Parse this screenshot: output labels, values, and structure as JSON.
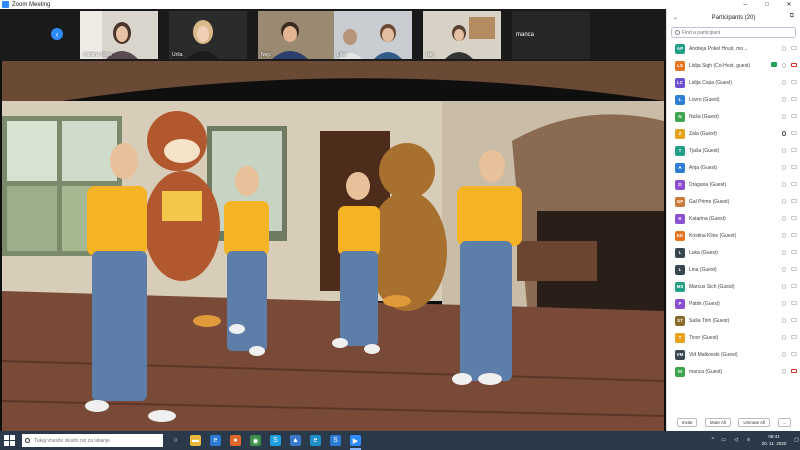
{
  "window": {
    "title": "Zoom Meeting",
    "controls": [
      "–",
      "□",
      "✕"
    ]
  },
  "thumbnails": [
    {
      "name": "Kristina Kline"
    },
    {
      "name": "Urša"
    },
    {
      "name": "Nejc"
    },
    {
      "name": "Ljko"
    },
    {
      "name": "Nej"
    },
    {
      "name": "manca"
    }
  ],
  "participants_panel": {
    "title": "Participants (20)",
    "search_placeholder": "Find a participant",
    "items": [
      {
        "initials": "AP",
        "name": "Andreja Pokel Hrust, mo...",
        "color": "#21a085",
        "mic": "muted",
        "cam": "on"
      },
      {
        "initials": "LS",
        "name": "Lidija Šigh (Co-Host, guest)",
        "color": "#e5741d",
        "mic": "muted",
        "cam": "off-red",
        "video": true
      },
      {
        "initials": "LC",
        "name": "Lidija Čupa (Guest)",
        "color": "#6b4fcf",
        "mic": "muted",
        "cam": "off"
      },
      {
        "initials": "L",
        "name": "Lovro (Guest)",
        "color": "#2f7fd6",
        "mic": "muted",
        "cam": "off"
      },
      {
        "initials": "N",
        "name": "Nuša (Guest)",
        "color": "#3ea64d",
        "mic": "muted",
        "cam": "off"
      },
      {
        "initials": "Z",
        "name": "Zala (Guest)",
        "color": "#e5a21d",
        "mic": "on",
        "cam": "off"
      },
      {
        "initials": "T",
        "name": "Tjaša (Guest)",
        "color": "#21a085",
        "mic": "muted",
        "cam": "off"
      },
      {
        "initials": "A",
        "name": "Anja (Guest)",
        "color": "#2f7fd6",
        "mic": "muted",
        "cam": "off"
      },
      {
        "initials": "D",
        "name": "Dragana (Guest)",
        "color": "#8c4fcf",
        "mic": "muted",
        "cam": "off"
      },
      {
        "initials": "GP",
        "name": "Gal Prime (Guest)",
        "color": "#c77a3a",
        "mic": "muted",
        "cam": "off"
      },
      {
        "initials": "K",
        "name": "Katarina (Guest)",
        "color": "#8c4fcf",
        "mic": "muted",
        "cam": "off"
      },
      {
        "initials": "KK",
        "name": "Kristina Kline (Guest)",
        "color": "#e5741d",
        "mic": "muted",
        "cam": "off"
      },
      {
        "initials": "L",
        "name": "Luka (Guest)",
        "color": "#37474f",
        "mic": "muted",
        "cam": "off"
      },
      {
        "initials": "L",
        "name": "Lina (Guest)",
        "color": "#37474f",
        "mic": "muted",
        "cam": "off"
      },
      {
        "initials": "MS",
        "name": "Marcus Sich (Guest)",
        "color": "#21a085",
        "mic": "muted",
        "cam": "off"
      },
      {
        "initials": "P",
        "name": "Patrik (Guest)",
        "color": "#8c4fcf",
        "mic": "muted",
        "cam": "off"
      },
      {
        "initials": "ST",
        "name": "Saša Tinh (Guest)",
        "color": "#8a6a2a",
        "mic": "muted",
        "cam": "off"
      },
      {
        "initials": "T",
        "name": "Tinor (Guest)",
        "color": "#e5a21d",
        "mic": "muted",
        "cam": "off"
      },
      {
        "initials": "VM",
        "name": "Vid Malkovski (Guest)",
        "color": "#37474f",
        "mic": "muted",
        "cam": "off"
      },
      {
        "initials": "M",
        "name": "manca (Guest)",
        "color": "#3ea64d",
        "mic": "muted",
        "cam": "off-red"
      }
    ],
    "buttons": {
      "invite": "Invite",
      "mute_all": "Mute All",
      "unmute_all": "Unmute All",
      "more": "..."
    }
  },
  "taskbar": {
    "search_placeholder": "Tukaj vnesite iskalni niz za iskanje",
    "apps": [
      {
        "icon": "task-view-icon",
        "color": "#2b3a4a",
        "symbol": "○"
      },
      {
        "icon": "file-explorer-icon",
        "color": "#e8b93a",
        "symbol": "▬"
      },
      {
        "icon": "edge-legacy-icon",
        "color": "#2b7bd4",
        "symbol": "e"
      },
      {
        "icon": "firefox-icon",
        "color": "#e0662a",
        "symbol": "●"
      },
      {
        "icon": "chrome-icon",
        "color": "#3d8f4a",
        "symbol": "◉"
      },
      {
        "icon": "skype-icon",
        "color": "#1da1e2",
        "symbol": "S"
      },
      {
        "icon": "photos-icon",
        "color": "#3a78c9",
        "symbol": "▲"
      },
      {
        "icon": "edge-icon",
        "color": "#1f8fc9",
        "symbol": "e"
      },
      {
        "icon": "skype-business-icon",
        "color": "#2b7bd4",
        "symbol": "S"
      },
      {
        "icon": "zoom-icon",
        "color": "#2d8cff",
        "symbol": "▶"
      }
    ],
    "time": "08:41",
    "date": "20. 11. 2020"
  }
}
